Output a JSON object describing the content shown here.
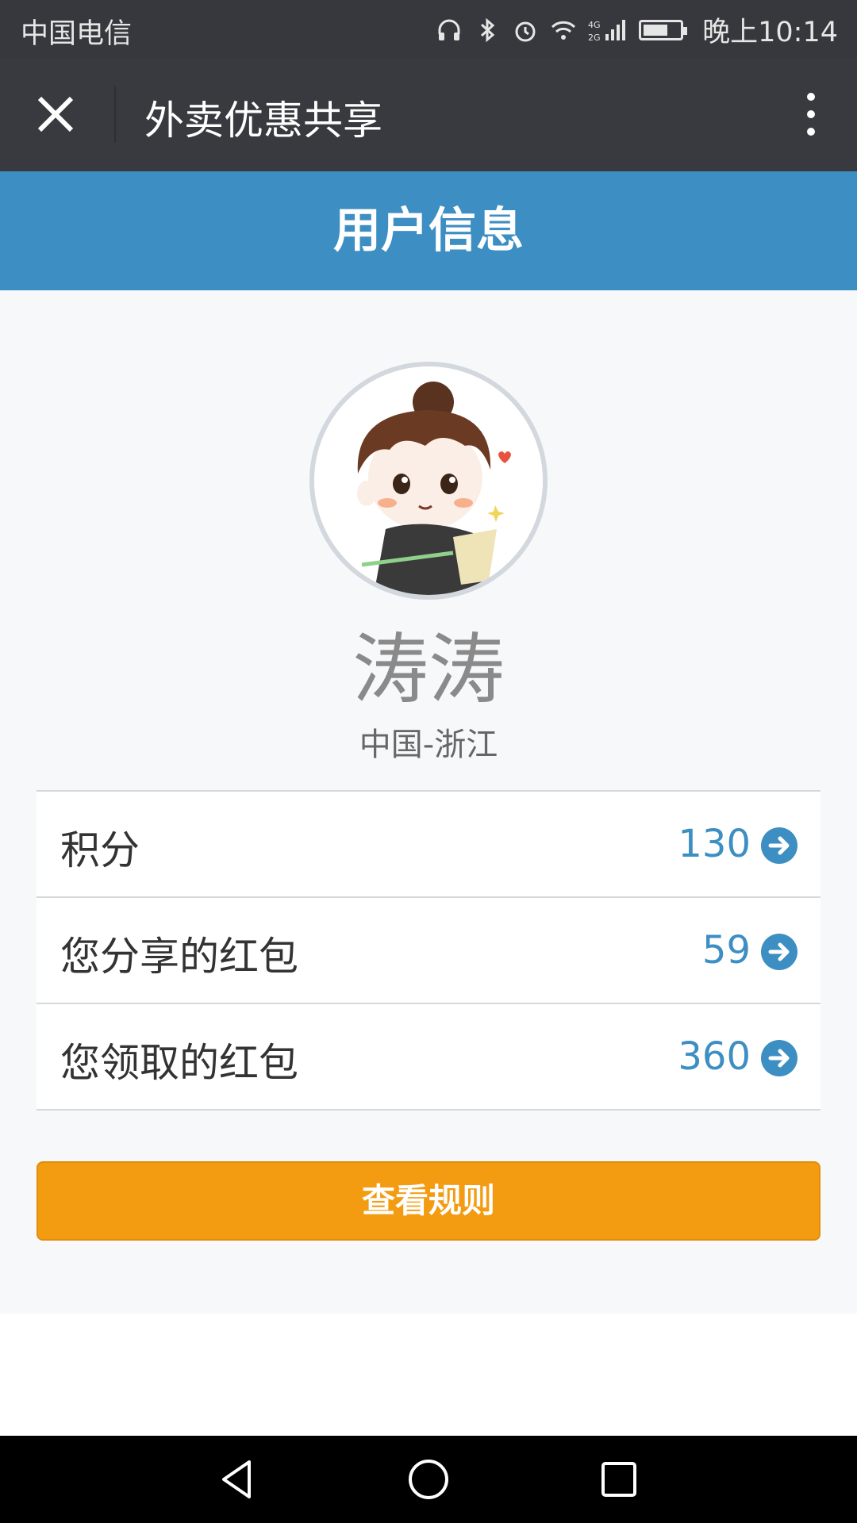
{
  "status_bar": {
    "carrier": "中国电信",
    "time": "晚上10:14",
    "network": "4G 2G"
  },
  "app_bar": {
    "title": "外卖优惠共享"
  },
  "title_bar": {
    "title": "用户信息"
  },
  "profile": {
    "name": "涛涛",
    "location": "中国-浙江"
  },
  "stats": [
    {
      "label": "积分",
      "value": "130"
    },
    {
      "label": "您分享的红包",
      "value": "59"
    },
    {
      "label": "您领取的红包",
      "value": "360"
    }
  ],
  "rules_button": {
    "label": "查看规则"
  },
  "colors": {
    "header_dark": "#393a3f",
    "title_blue": "#3d8ec2",
    "button_orange": "#f39c12",
    "value_blue": "#3d8ec2"
  }
}
